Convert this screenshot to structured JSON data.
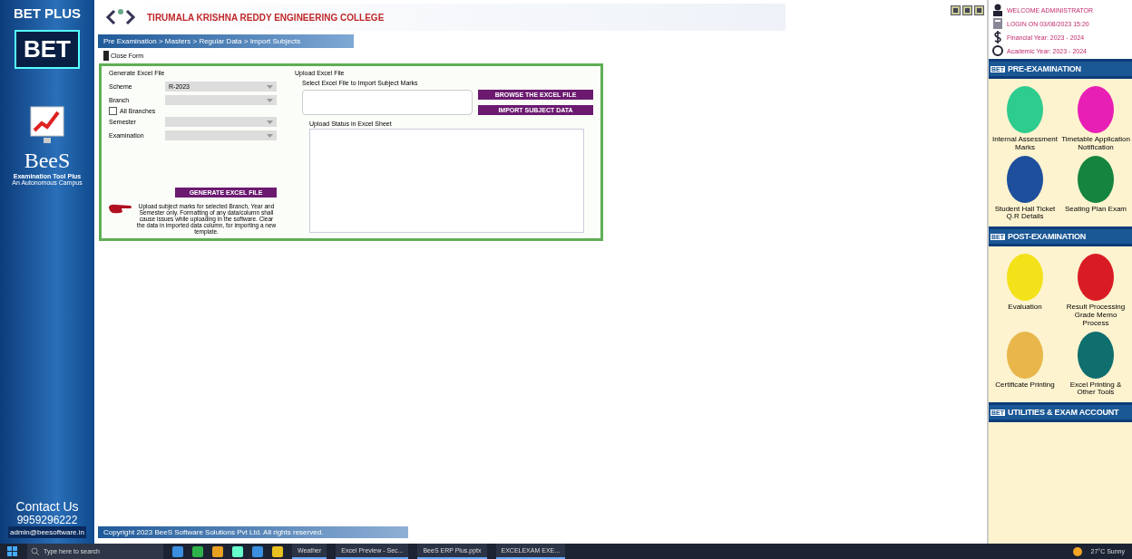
{
  "sidebar": {
    "brand": "BET PLUS",
    "badge": "BET",
    "product": "BeeS",
    "tagline": "Examination Tool Plus",
    "subtitle": "An Autonomous Campus",
    "contact_title": "Contact Us",
    "phone": "9959296222",
    "email": "admin@beesoftware.in"
  },
  "header": {
    "college": "TIRUMALA KRISHNA REDDY ENGINEERING COLLEGE",
    "breadcrumb": "Pre Examination > Masters > Regular Data > Import Subjects",
    "toolbar_button": "Close Form"
  },
  "generate": {
    "title": "Generate Excel File",
    "fields": [
      {
        "label": "Scheme",
        "value": "R-2023"
      },
      {
        "label": "Branch"
      },
      {
        "label": "Semester"
      },
      {
        "label": "Examination"
      }
    ],
    "all_branches": {
      "label": "All Branches",
      "checked": false
    },
    "button": "GENERATE EXCEL FILE",
    "note": "Upload subject marks for selected Branch, Year and Semester only. Formatting of any data/column shall cause issues while uploading in the software. Clear the data in imported data column, for importing a new template."
  },
  "upload": {
    "title": "Upload Excel File",
    "prompt": "Select Excel File to Import Subject Marks",
    "buttons": [
      "BROWSE THE EXCEL FILE",
      "IMPORT SUBJECT DATA"
    ],
    "status_label": "Upload Status in Excel Sheet"
  },
  "status_bar": "Copyright 2023 BeeS Software Solutions Pvt Ltd. All rights reserved.",
  "info": [
    "WELCOME ADMINISTRATOR",
    "LOGIN ON 03/08/2023 15:20",
    "Financial Year: 2023 - 2024",
    "Academic Year: 2023 - 2024"
  ],
  "sections": [
    {
      "badge": "BET",
      "title": "PRE-EXAMINATION",
      "tiles": [
        {
          "label": "Internal Assessment Marks",
          "color": "#2ecc8e"
        },
        {
          "label": "Timetable Application Notification",
          "color": "#e81fb5"
        },
        {
          "label": "Student Hall Ticket Q.R Details",
          "color": "#1d4f9c"
        },
        {
          "label": "Seating Plan Exam",
          "color": "#15843f"
        }
      ]
    },
    {
      "badge": "BET",
      "title": "POST-EXAMINATION",
      "tiles": [
        {
          "label": "Evaluation",
          "color": "#f3e21a"
        },
        {
          "label": "Result Processing Grade Memo Process",
          "color": "#d91c24"
        },
        {
          "label": "Certificate Printing",
          "color": "#e8b64a"
        },
        {
          "label": "Excel Printing & Other Tools",
          "color": "#0f6e6e"
        }
      ]
    },
    {
      "badge": "BET",
      "title": "UTILITIES & EXAM ACCOUNT"
    }
  ],
  "taskbar": {
    "search": "Type here to search",
    "apps": [
      "Weather",
      "Excel Preview - Sec...",
      "BeeS ERP Plus.pptx",
      "EXCELEXAM EXE..."
    ],
    "tray": "27°C Sunny"
  }
}
